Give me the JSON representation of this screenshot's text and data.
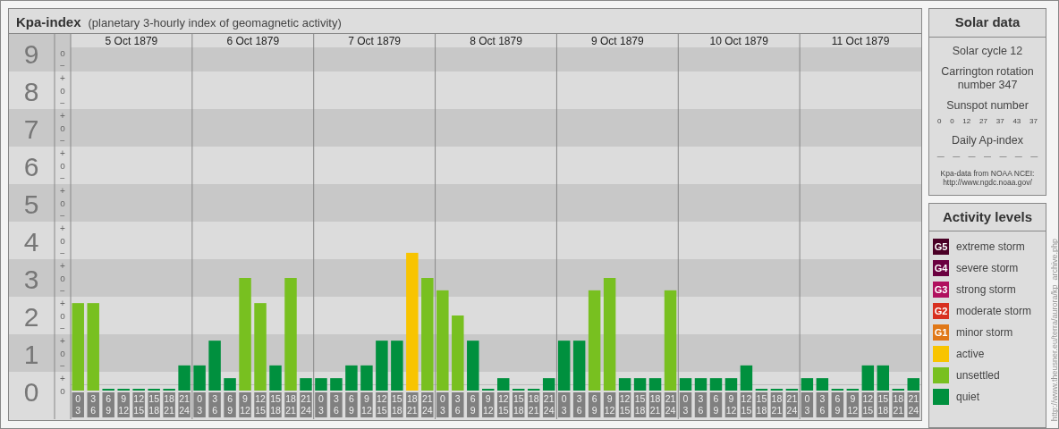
{
  "kp_panel": {
    "title": "Kpa-index",
    "subtitle": "(planetary 3-hourly index of geomagnetic activity)",
    "days": [
      "5 Oct 1879",
      "6 Oct 1879",
      "7 Oct 1879",
      "8 Oct 1879",
      "9 Oct 1879",
      "10 Oct 1879",
      "11 Oct 1879"
    ],
    "y_marks": [
      "o",
      "−",
      "+",
      "o",
      "−",
      "+",
      "o",
      "−",
      "+",
      "o",
      "−",
      "+",
      "o",
      "−",
      "+",
      "o",
      "−",
      "+",
      "o",
      "−",
      "+",
      "o",
      "−",
      "+",
      "o",
      "−",
      "+",
      "o"
    ],
    "chart_data": {
      "type": "bar",
      "stacked": true,
      "ylim": [
        0,
        9.5
      ],
      "grid": true,
      "yticks": [
        {
          "value": 0,
          "label": "0"
        },
        {
          "value": 1,
          "label": "1"
        },
        {
          "value": 2,
          "label": "2"
        },
        {
          "value": 3,
          "label": "3"
        },
        {
          "value": 4,
          "label": "4"
        },
        {
          "value": 5,
          "label": "5"
        },
        {
          "value": 6,
          "label": "6"
        },
        {
          "value": 7,
          "label": "7"
        },
        {
          "value": 8,
          "label": "8"
        },
        {
          "value": 9,
          "label": "9"
        }
      ],
      "categories": [
        "0\n3",
        "3\n6",
        "6\n9",
        "9\n12",
        "12\n15",
        "15\n18",
        "18\n21",
        "21\n24",
        "0\n3",
        "3\n6",
        "6\n9",
        "9\n12",
        "12\n15",
        "15\n18",
        "18\n21",
        "21\n24",
        "0\n3",
        "3\n6",
        "6\n9",
        "9\n12",
        "12\n15",
        "15\n18",
        "18\n21",
        "21\n24",
        "0\n3",
        "3\n6",
        "6\n9",
        "9\n12",
        "12\n15",
        "15\n18",
        "18\n21",
        "21\n24",
        "0\n3",
        "3\n6",
        "6\n9",
        "9\n12",
        "12\n15",
        "15\n18",
        "18\n21",
        "21\n24",
        "0\n3",
        "3\n6",
        "6\n9",
        "9\n12",
        "12\n15",
        "15\n18",
        "18\n21",
        "21\n24",
        "0\n3",
        "3\n6",
        "6\n9",
        "9\n12",
        "12\n15",
        "15\n18",
        "18\n21",
        "21\n24"
      ],
      "series": [
        {
          "name": "active",
          "color": "#f8c400",
          "values": [
            null,
            null,
            null,
            null,
            null,
            null,
            null,
            null,
            null,
            null,
            null,
            null,
            null,
            null,
            null,
            null,
            null,
            null,
            null,
            null,
            null,
            null,
            3.67,
            null,
            null,
            null,
            null,
            null,
            null,
            null,
            null,
            null,
            null,
            null,
            null,
            null,
            null,
            null,
            null,
            null,
            null,
            null,
            null,
            null,
            null,
            null,
            null,
            null,
            null,
            null,
            null,
            null,
            null,
            null,
            null,
            null
          ]
        },
        {
          "name": "unsettled",
          "color": "#78c020",
          "values": [
            2.33,
            2.33,
            null,
            null,
            null,
            null,
            null,
            null,
            null,
            null,
            null,
            3,
            2.33,
            null,
            3,
            null,
            null,
            null,
            null,
            null,
            null,
            null,
            null,
            3,
            2.67,
            2,
            null,
            null,
            null,
            null,
            null,
            null,
            null,
            null,
            2.67,
            3,
            null,
            null,
            null,
            2.67,
            null,
            null,
            null,
            null,
            null,
            null,
            null,
            null,
            null,
            null,
            null,
            null,
            null,
            null,
            null,
            null
          ]
        },
        {
          "name": "quiet",
          "color": "#00903e",
          "values": [
            null,
            null,
            0,
            0,
            0,
            0,
            0,
            0.67,
            0.67,
            1.33,
            0.33,
            null,
            null,
            0.67,
            null,
            0.33,
            0.33,
            0.33,
            0.67,
            0.67,
            1.33,
            1.33,
            null,
            null,
            null,
            null,
            1.33,
            0,
            0.33,
            0,
            0,
            0.33,
            1.33,
            1.33,
            null,
            null,
            0.33,
            0.33,
            0.33,
            null,
            0.33,
            0.33,
            0.33,
            0.33,
            0.67,
            0,
            0,
            0,
            0.33,
            0.33,
            0,
            0,
            0.67,
            0.67,
            0,
            0.33
          ]
        }
      ]
    }
  },
  "solar_data": {
    "title": "Solar data",
    "solar_cycle": "Solar cycle 12",
    "carrington": "Carrington rotation number 347",
    "sunspot_label": "Sunspot number",
    "sunspot_numbers": [
      "0",
      "0",
      "12",
      "27",
      "37",
      "43",
      "37"
    ],
    "ap_label": "Daily Ap-index",
    "ap_values": [
      "—",
      "—",
      "—",
      "—",
      "—",
      "—",
      "—"
    ],
    "source": "Kpa-data from NOAA NCEI:",
    "source_url": "http://www.ngdc.noaa.gov/"
  },
  "activity_levels": {
    "title": "Activity levels",
    "items": [
      {
        "badge": "G5",
        "label": "extreme storm",
        "color": "#4a0026"
      },
      {
        "badge": "G4",
        "label": "severe storm",
        "color": "#6a0040"
      },
      {
        "badge": "G3",
        "label": "strong storm",
        "color": "#b0105e"
      },
      {
        "badge": "G2",
        "label": "moderate storm",
        "color": "#d83020"
      },
      {
        "badge": "G1",
        "label": "minor storm",
        "color": "#e07818"
      }
    ]
  },
  "credit": "http://www.theusner.eu/terra/aurora/kp_archive.php"
}
